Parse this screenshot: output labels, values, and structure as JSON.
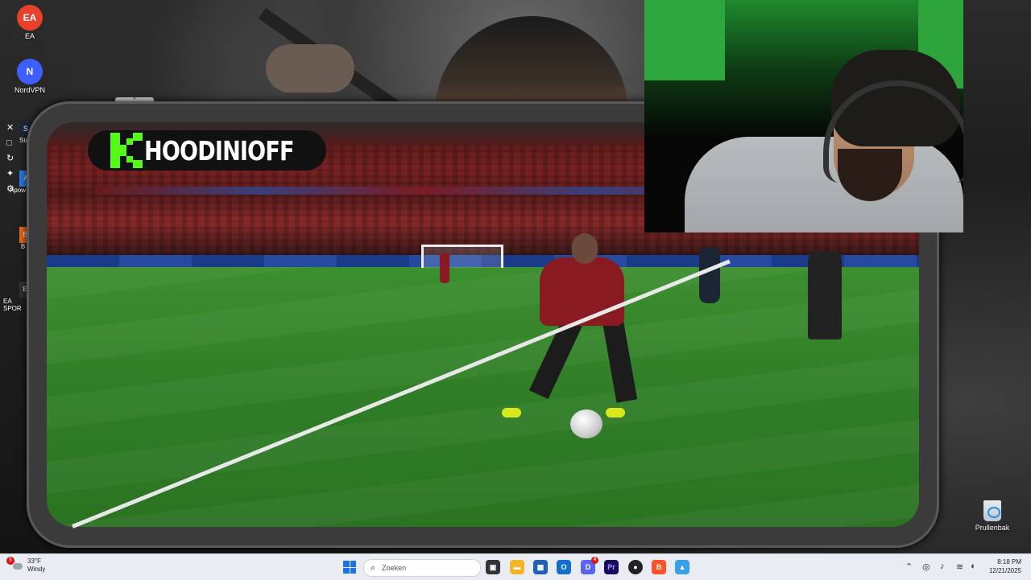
{
  "desktop": {
    "icons": [
      {
        "label": "EA",
        "glyph": "EA",
        "color": "#e8402a"
      },
      {
        "label": "NordVPN",
        "glyph": "N",
        "color": "#3e5fff"
      },
      {
        "label": "Ste",
        "glyph": "S",
        "color": "#1b2838"
      },
      {
        "label": "Apow",
        "glyph": "A",
        "color": "#2a7be4"
      },
      {
        "label": "B",
        "glyph": "B",
        "color": "#e86a1a"
      },
      {
        "label": "EA SPOR",
        "glyph": "E",
        "color": "#333333"
      }
    ],
    "recycle_bin_label": "Prullenbak"
  },
  "stream": {
    "channel_name": "HOODINIOFF",
    "platform_icon": "kick-logo-icon",
    "platform_color": "#53fc18"
  },
  "taskbar": {
    "weather": {
      "temperature": "33°F",
      "condition": "Windy",
      "alert_count": "5"
    },
    "search_placeholder": "Zoeken",
    "apps": [
      {
        "name": "task-view-icon",
        "glyph": "▣"
      },
      {
        "name": "file-explorer-icon",
        "glyph": "▬"
      },
      {
        "name": "calculator-icon",
        "glyph": "▦"
      },
      {
        "name": "outlook-icon",
        "glyph": "O"
      },
      {
        "name": "discord-icon",
        "glyph": "D",
        "badge": "4"
      },
      {
        "name": "premiere-pro-icon",
        "glyph": "Pr"
      },
      {
        "name": "obs-icon",
        "glyph": "●"
      },
      {
        "name": "brave-icon",
        "glyph": "B"
      },
      {
        "name": "photos-icon",
        "glyph": "▲"
      }
    ],
    "time": "8:18 PM",
    "date": "12/21/2025"
  }
}
